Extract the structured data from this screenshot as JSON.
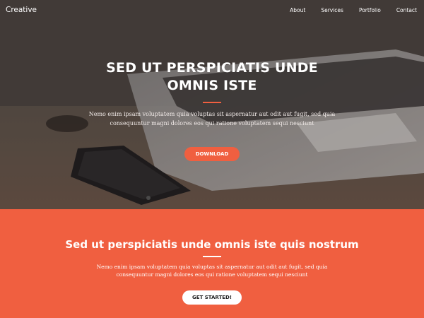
{
  "nav": {
    "brand": "Creative",
    "links": [
      "About",
      "Services",
      "Portfolio",
      "Contact"
    ]
  },
  "hero": {
    "title": "SED UT PERSPICIATIS UNDE OMNIS ISTE",
    "text": "Nemo enim ipsam voluptatem quia voluptas sit aspernatur aut odit aut fugit, sed quia consequuntur magni dolores eos qui ratione voluptatem sequi nesciunt",
    "button": "DOWNLOAD"
  },
  "section": {
    "title": "Sed ut perspiciatis unde omnis iste quis nostrum",
    "text": "Nemo enim ipsam voluptatem quia voluptas sit aspernatur aut odit aut fugit, sed quia consequuntur magni dolores eos qui ratione voluptatem sequi nesciunt",
    "button": "GET STARTED!"
  },
  "colors": {
    "accent": "#f05f40",
    "white": "#ffffff"
  }
}
